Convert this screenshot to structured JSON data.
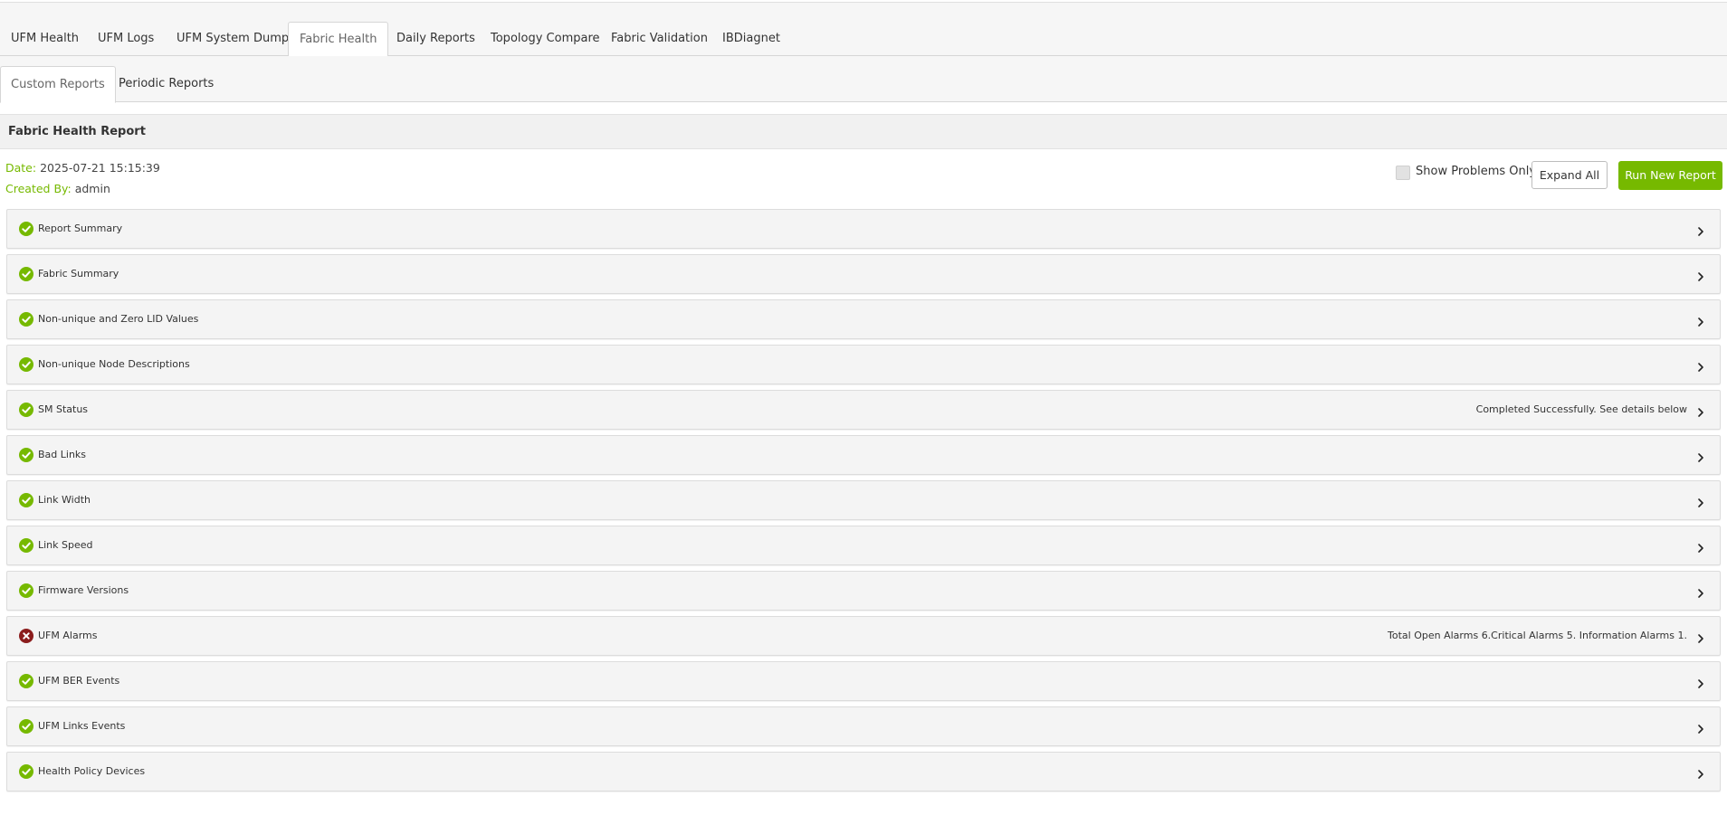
{
  "main_tabs": [
    {
      "label": "UFM Health",
      "active": false
    },
    {
      "label": "UFM Logs",
      "active": false
    },
    {
      "label": "UFM System Dump",
      "active": false
    },
    {
      "label": "Fabric Health",
      "active": true
    },
    {
      "label": "Daily Reports",
      "active": false
    },
    {
      "label": "Topology Compare",
      "active": false
    },
    {
      "label": "Fabric Validation",
      "active": false
    },
    {
      "label": "IBDiagnet",
      "active": false
    }
  ],
  "sub_tabs": [
    {
      "label": "Custom Reports",
      "active": true
    },
    {
      "label": "Periodic Reports",
      "active": false
    }
  ],
  "report": {
    "title": "Fabric Health Report",
    "date_label": "Date:",
    "date_value": "2025-07-21 15:15:39",
    "created_by_label": "Created By:",
    "created_by_value": "admin"
  },
  "toolbar": {
    "show_problems_label": "Show Problems Only",
    "show_problems_checked": false,
    "expand_all_label": "Expand All",
    "run_new_report_label": "Run New Report"
  },
  "sections": [
    {
      "label": "Report Summary",
      "status": "ok",
      "summary": ""
    },
    {
      "label": "Fabric Summary",
      "status": "ok",
      "summary": ""
    },
    {
      "label": "Non-unique and Zero LID Values",
      "status": "ok",
      "summary": ""
    },
    {
      "label": "Non-unique Node Descriptions",
      "status": "ok",
      "summary": ""
    },
    {
      "label": "SM Status",
      "status": "ok",
      "summary": "Completed Successfully. See details below"
    },
    {
      "label": "Bad Links",
      "status": "ok",
      "summary": ""
    },
    {
      "label": "Link Width",
      "status": "ok",
      "summary": ""
    },
    {
      "label": "Link Speed",
      "status": "ok",
      "summary": ""
    },
    {
      "label": "Firmware Versions",
      "status": "ok",
      "summary": ""
    },
    {
      "label": "UFM Alarms",
      "status": "error",
      "summary": "Total Open Alarms 6.Critical Alarms 5. Information Alarms 1."
    },
    {
      "label": "UFM BER Events",
      "status": "ok",
      "summary": ""
    },
    {
      "label": "UFM Links Events",
      "status": "ok",
      "summary": ""
    },
    {
      "label": "Health Policy Devices",
      "status": "ok",
      "summary": ""
    }
  ],
  "colors": {
    "accent_green": "#76b900",
    "error_red": "#8b1d1d"
  },
  "icons": {
    "ok": "check-circle-icon",
    "error": "x-circle-icon",
    "expand": "chevron-right-icon"
  }
}
